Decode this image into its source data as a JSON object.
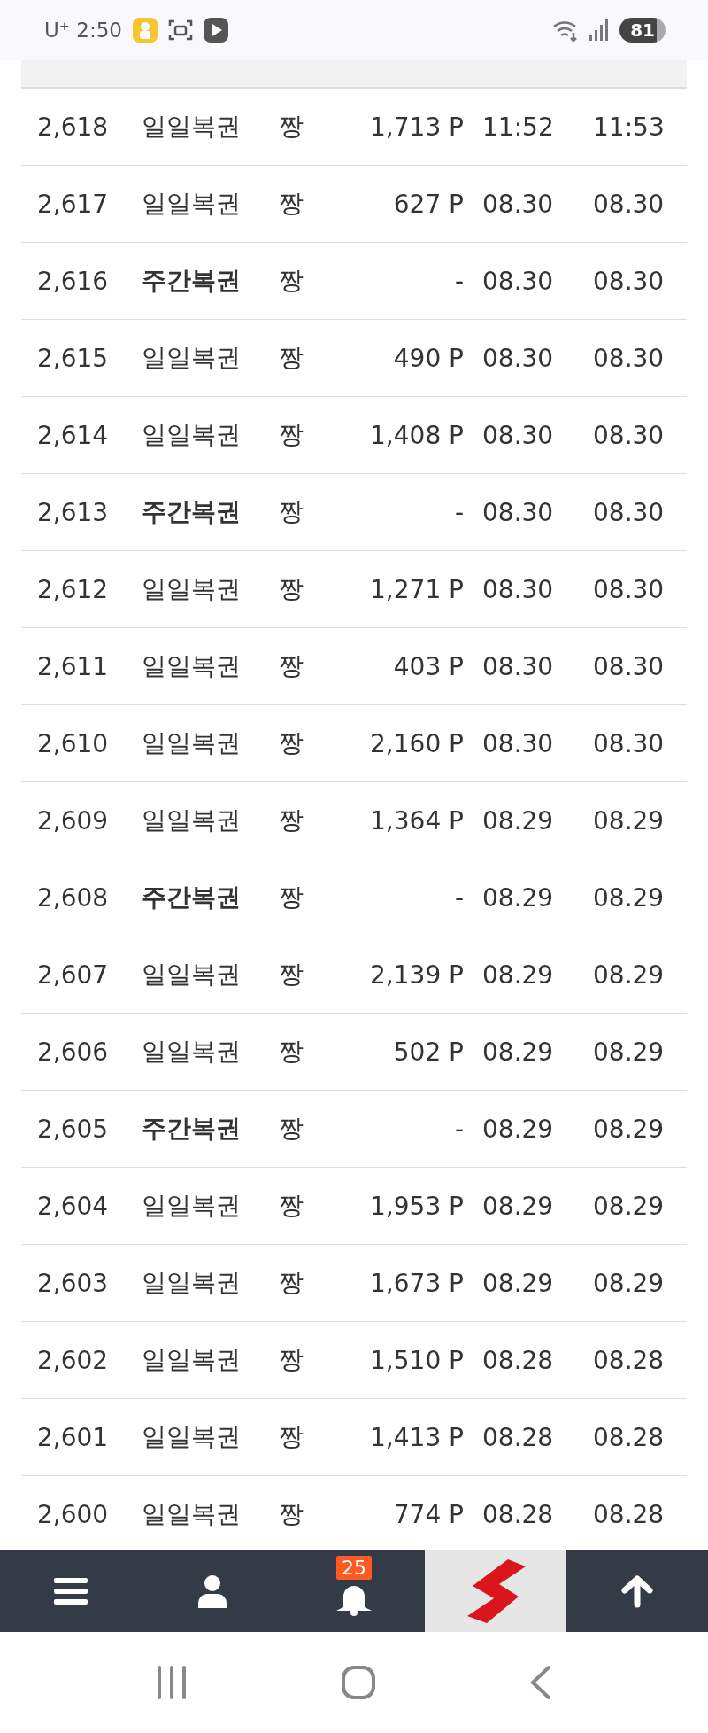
{
  "status_bar": {
    "carrier": "U⁺",
    "time": "2:50",
    "battery": "81"
  },
  "rows": [
    {
      "number": "2,618",
      "type": "일일복권",
      "kind": "daily",
      "grade": "짱",
      "points": "1,713 P",
      "time_1": "11:52",
      "time_2": "11:53"
    },
    {
      "number": "2,617",
      "type": "일일복권",
      "kind": "daily",
      "grade": "짱",
      "points": "627 P",
      "time_1": "08.30",
      "time_2": "08.30"
    },
    {
      "number": "2,616",
      "type": "주간복권",
      "kind": "weekly",
      "grade": "짱",
      "points": "-",
      "time_1": "08.30",
      "time_2": "08.30"
    },
    {
      "number": "2,615",
      "type": "일일복권",
      "kind": "daily",
      "grade": "짱",
      "points": "490 P",
      "time_1": "08.30",
      "time_2": "08.30"
    },
    {
      "number": "2,614",
      "type": "일일복권",
      "kind": "daily",
      "grade": "짱",
      "points": "1,408 P",
      "time_1": "08.30",
      "time_2": "08.30"
    },
    {
      "number": "2,613",
      "type": "주간복권",
      "kind": "weekly",
      "grade": "짱",
      "points": "-",
      "time_1": "08.30",
      "time_2": "08.30"
    },
    {
      "number": "2,612",
      "type": "일일복권",
      "kind": "daily",
      "grade": "짱",
      "points": "1,271 P",
      "time_1": "08.30",
      "time_2": "08.30"
    },
    {
      "number": "2,611",
      "type": "일일복권",
      "kind": "daily",
      "grade": "짱",
      "points": "403 P",
      "time_1": "08.30",
      "time_2": "08.30"
    },
    {
      "number": "2,610",
      "type": "일일복권",
      "kind": "daily",
      "grade": "짱",
      "points": "2,160 P",
      "time_1": "08.30",
      "time_2": "08.30"
    },
    {
      "number": "2,609",
      "type": "일일복권",
      "kind": "daily",
      "grade": "짱",
      "points": "1,364 P",
      "time_1": "08.29",
      "time_2": "08.29"
    },
    {
      "number": "2,608",
      "type": "주간복권",
      "kind": "weekly",
      "grade": "짱",
      "points": "-",
      "time_1": "08.29",
      "time_2": "08.29"
    },
    {
      "number": "2,607",
      "type": "일일복권",
      "kind": "daily",
      "grade": "짱",
      "points": "2,139 P",
      "time_1": "08.29",
      "time_2": "08.29"
    },
    {
      "number": "2,606",
      "type": "일일복권",
      "kind": "daily",
      "grade": "짱",
      "points": "502 P",
      "time_1": "08.29",
      "time_2": "08.29"
    },
    {
      "number": "2,605",
      "type": "주간복권",
      "kind": "weekly",
      "grade": "짱",
      "points": "-",
      "time_1": "08.29",
      "time_2": "08.29"
    },
    {
      "number": "2,604",
      "type": "일일복권",
      "kind": "daily",
      "grade": "짱",
      "points": "1,953 P",
      "time_1": "08.29",
      "time_2": "08.29"
    },
    {
      "number": "2,603",
      "type": "일일복권",
      "kind": "daily",
      "grade": "짱",
      "points": "1,673 P",
      "time_1": "08.29",
      "time_2": "08.29"
    },
    {
      "number": "2,602",
      "type": "일일복권",
      "kind": "daily",
      "grade": "짱",
      "points": "1,510 P",
      "time_1": "08.28",
      "time_2": "08.28"
    },
    {
      "number": "2,601",
      "type": "일일복권",
      "kind": "daily",
      "grade": "짱",
      "points": "1,413 P",
      "time_1": "08.28",
      "time_2": "08.28"
    },
    {
      "number": "2,600",
      "type": "일일복권",
      "kind": "daily",
      "grade": "짱",
      "points": "774 P",
      "time_1": "08.28",
      "time_2": "08.28"
    }
  ],
  "bottom_bar": {
    "notification_count": "25"
  }
}
